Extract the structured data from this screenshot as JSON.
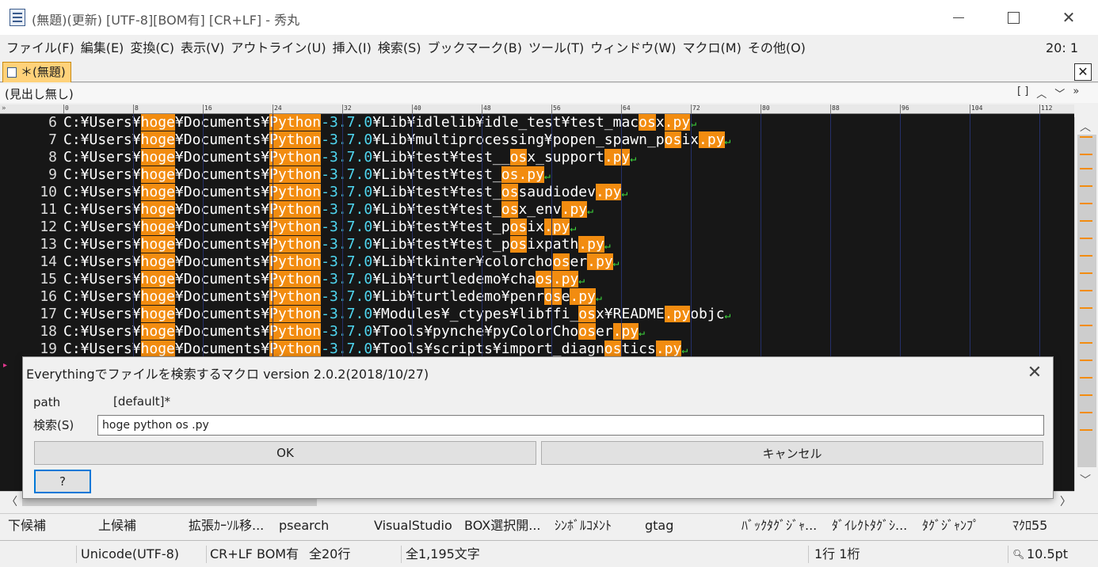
{
  "window": {
    "title": "(無題)(更新) [UTF-8][BOM有] [CR+LF] - 秀丸",
    "cursor_pos": "20: 1"
  },
  "menu": [
    "ファイル(F)",
    "編集(E)",
    "変換(C)",
    "表示(V)",
    "アウトライン(U)",
    "挿入(I)",
    "検索(S)",
    "ブックマーク(B)",
    "ツール(T)",
    "ウィンドウ(W)",
    "マクロ(M)",
    "その他(O)"
  ],
  "tab": {
    "label": "＊(無題)",
    "close_label": "✕"
  },
  "heading": {
    "label": "(見出し無し)",
    "controls": [
      "[ ]",
      "︿",
      "﹀",
      "»"
    ]
  },
  "ruler": {
    "marks": [
      "0",
      "8",
      "16",
      "24",
      "32",
      "40",
      "48",
      "56",
      "64",
      "72",
      "80",
      "88",
      "96",
      "104",
      "112"
    ]
  },
  "editor": {
    "eol_mark": "↵",
    "lines": [
      {
        "num": "6",
        "parts": [
          [
            "n",
            "C:¥Users¥"
          ],
          [
            "h",
            "hoge"
          ],
          [
            "n",
            "¥Documents¥"
          ],
          [
            "h",
            "Python"
          ],
          [
            "v",
            "-3.7.0"
          ],
          [
            "n",
            "¥Lib¥idlelib¥idle_test¥test_mac"
          ],
          [
            "h",
            "os"
          ],
          [
            "n",
            "x"
          ],
          [
            "h",
            ".py"
          ]
        ]
      },
      {
        "num": "7",
        "parts": [
          [
            "n",
            "C:¥Users¥"
          ],
          [
            "h",
            "hoge"
          ],
          [
            "n",
            "¥Documents¥"
          ],
          [
            "h",
            "Python"
          ],
          [
            "v",
            "-3.7.0"
          ],
          [
            "n",
            "¥Lib¥multiprocessing¥popen_spawn_p"
          ],
          [
            "h",
            "os"
          ],
          [
            "n",
            "ix"
          ],
          [
            "h",
            ".py"
          ]
        ]
      },
      {
        "num": "8",
        "parts": [
          [
            "n",
            "C:¥Users¥"
          ],
          [
            "h",
            "hoge"
          ],
          [
            "n",
            "¥Documents¥"
          ],
          [
            "h",
            "Python"
          ],
          [
            "v",
            "-3.7.0"
          ],
          [
            "n",
            "¥Lib¥test¥test__"
          ],
          [
            "h",
            "os"
          ],
          [
            "n",
            "x_support"
          ],
          [
            "h",
            ".py"
          ]
        ]
      },
      {
        "num": "9",
        "parts": [
          [
            "n",
            "C:¥Users¥"
          ],
          [
            "h",
            "hoge"
          ],
          [
            "n",
            "¥Documents¥"
          ],
          [
            "h",
            "Python"
          ],
          [
            "v",
            "-3.7.0"
          ],
          [
            "n",
            "¥Lib¥test¥test_"
          ],
          [
            "h",
            "os"
          ],
          [
            "h",
            ".py"
          ]
        ]
      },
      {
        "num": "10",
        "parts": [
          [
            "n",
            "C:¥Users¥"
          ],
          [
            "h",
            "hoge"
          ],
          [
            "n",
            "¥Documents¥"
          ],
          [
            "h",
            "Python"
          ],
          [
            "v",
            "-3.7.0"
          ],
          [
            "n",
            "¥Lib¥test¥test_"
          ],
          [
            "h",
            "os"
          ],
          [
            "n",
            "saudiodev"
          ],
          [
            "h",
            ".py"
          ]
        ]
      },
      {
        "num": "11",
        "parts": [
          [
            "n",
            "C:¥Users¥"
          ],
          [
            "h",
            "hoge"
          ],
          [
            "n",
            "¥Documents¥"
          ],
          [
            "h",
            "Python"
          ],
          [
            "v",
            "-3.7.0"
          ],
          [
            "n",
            "¥Lib¥test¥test_"
          ],
          [
            "h",
            "os"
          ],
          [
            "n",
            "x_env"
          ],
          [
            "h",
            ".py"
          ]
        ]
      },
      {
        "num": "12",
        "parts": [
          [
            "n",
            "C:¥Users¥"
          ],
          [
            "h",
            "hoge"
          ],
          [
            "n",
            "¥Documents¥"
          ],
          [
            "h",
            "Python"
          ],
          [
            "v",
            "-3.7.0"
          ],
          [
            "n",
            "¥Lib¥test¥test_p"
          ],
          [
            "h",
            "os"
          ],
          [
            "n",
            "ix"
          ],
          [
            "h",
            ".py"
          ]
        ]
      },
      {
        "num": "13",
        "parts": [
          [
            "n",
            "C:¥Users¥"
          ],
          [
            "h",
            "hoge"
          ],
          [
            "n",
            "¥Documents¥"
          ],
          [
            "h",
            "Python"
          ],
          [
            "v",
            "-3.7.0"
          ],
          [
            "n",
            "¥Lib¥test¥test_p"
          ],
          [
            "h",
            "os"
          ],
          [
            "n",
            "ixpath"
          ],
          [
            "h",
            ".py"
          ]
        ]
      },
      {
        "num": "14",
        "parts": [
          [
            "n",
            "C:¥Users¥"
          ],
          [
            "h",
            "hoge"
          ],
          [
            "n",
            "¥Documents¥"
          ],
          [
            "h",
            "Python"
          ],
          [
            "v",
            "-3.7.0"
          ],
          [
            "n",
            "¥Lib¥tkinter¥colorcho"
          ],
          [
            "h",
            "os"
          ],
          [
            "n",
            "er"
          ],
          [
            "h",
            ".py"
          ]
        ]
      },
      {
        "num": "15",
        "parts": [
          [
            "n",
            "C:¥Users¥"
          ],
          [
            "h",
            "hoge"
          ],
          [
            "n",
            "¥Documents¥"
          ],
          [
            "h",
            "Python"
          ],
          [
            "v",
            "-3.7.0"
          ],
          [
            "n",
            "¥Lib¥turtledemo¥cha"
          ],
          [
            "h",
            "os"
          ],
          [
            "h",
            ".py"
          ]
        ]
      },
      {
        "num": "16",
        "parts": [
          [
            "n",
            "C:¥Users¥"
          ],
          [
            "h",
            "hoge"
          ],
          [
            "n",
            "¥Documents¥"
          ],
          [
            "h",
            "Python"
          ],
          [
            "v",
            "-3.7.0"
          ],
          [
            "n",
            "¥Lib¥turtledemo¥penr"
          ],
          [
            "h",
            "os"
          ],
          [
            "n",
            "e"
          ],
          [
            "h",
            ".py"
          ]
        ]
      },
      {
        "num": "17",
        "parts": [
          [
            "n",
            "C:¥Users¥"
          ],
          [
            "h",
            "hoge"
          ],
          [
            "n",
            "¥Documents¥"
          ],
          [
            "h",
            "Python"
          ],
          [
            "v",
            "-3.7.0"
          ],
          [
            "n",
            "¥Modules¥_ctypes¥libffi_"
          ],
          [
            "h",
            "os"
          ],
          [
            "n",
            "x¥README"
          ],
          [
            "h",
            ".py"
          ],
          [
            "n",
            "objc"
          ]
        ]
      },
      {
        "num": "18",
        "parts": [
          [
            "n",
            "C:¥Users¥"
          ],
          [
            "h",
            "hoge"
          ],
          [
            "n",
            "¥Documents¥"
          ],
          [
            "h",
            "Python"
          ],
          [
            "v",
            "-3.7.0"
          ],
          [
            "n",
            "¥Tools¥pynche¥pyColorCho"
          ],
          [
            "h",
            "os"
          ],
          [
            "n",
            "er"
          ],
          [
            "h",
            ".py"
          ]
        ]
      },
      {
        "num": "19",
        "parts": [
          [
            "n",
            "C:¥Users¥"
          ],
          [
            "h",
            "hoge"
          ],
          [
            "n",
            "¥Documents¥"
          ],
          [
            "h",
            "Python"
          ],
          [
            "v",
            "-3.7.0"
          ],
          [
            "n",
            "¥Tools¥scripts¥import_diagn"
          ],
          [
            "h",
            "os"
          ],
          [
            "n",
            "tics"
          ],
          [
            "h",
            ".py"
          ]
        ]
      }
    ]
  },
  "dialog": {
    "title": "Everythingでファイルを検索するマクロ version 2.0.2(2018/10/27)",
    "path_label": "path",
    "path_value": "[default]*",
    "search_label": "検索(S)",
    "search_value": "hoge python os .py",
    "ok_label": "OK",
    "cancel_label": "キャンセル",
    "help_label": "?"
  },
  "fkeys": [
    "下候補",
    "上候補",
    "拡張ｶｰｿﾙ移...",
    "psearch",
    "VisualStudio",
    "BOX選択開...",
    "ｼﾝﾎﾞﾙｺﾒﾝﾄ",
    "gtag",
    "ﾊﾞｯｸﾀｸﾞｼﾞｬ...",
    "ﾀﾞｲﾚｸﾄﾀｸﾞｼ...",
    "ﾀｸﾞｼﾞｬﾝﾌﾟ",
    "ﾏｸﾛ55"
  ],
  "status": {
    "encoding": "Unicode(UTF-8)",
    "newline": "CR+LF",
    "bom": "BOM有",
    "total_lines": "全20行",
    "total_chars": "全1,195文字",
    "position": "1行 1桁",
    "zoom": "10.5pt"
  },
  "colors": {
    "editor_bg": "#171717",
    "highlight": "#f28c10",
    "version_text": "#4fd6f0",
    "eol": "#3ddc3d",
    "tab_active": "#ffd27a"
  }
}
